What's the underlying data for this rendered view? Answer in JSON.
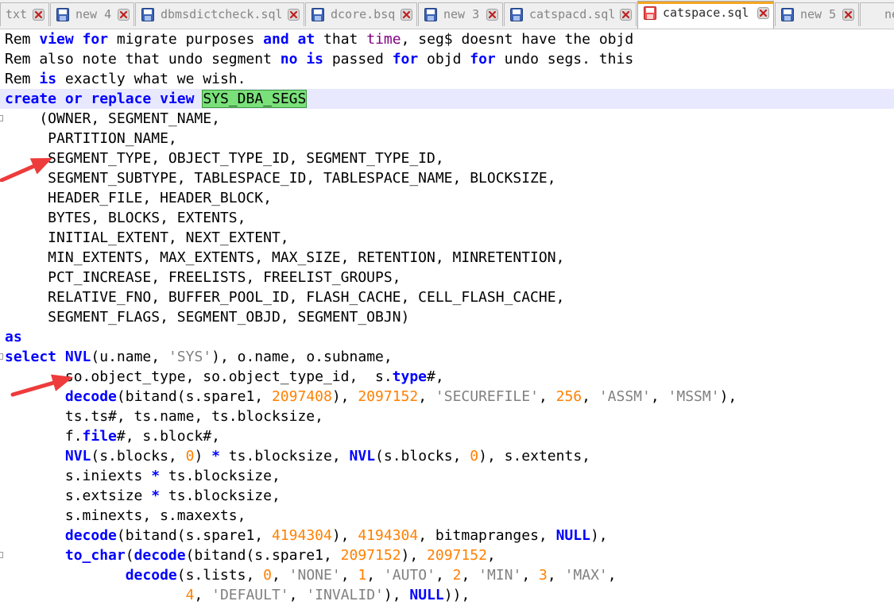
{
  "tabs": [
    {
      "label": "txt",
      "icon": "none",
      "active": false
    },
    {
      "label": "new 4",
      "icon": "saved-file-icon",
      "active": false
    },
    {
      "label": "dbmsdictcheck.sql",
      "icon": "saved-file-icon",
      "active": false
    },
    {
      "label": "dcore.bsq",
      "icon": "saved-file-icon",
      "active": false
    },
    {
      "label": "new 3",
      "icon": "saved-file-icon",
      "active": false
    },
    {
      "label": "catspacd.sql",
      "icon": "saved-file-icon",
      "active": false
    },
    {
      "label": "catspace.sql",
      "icon": "unsaved-file-icon",
      "active": true
    },
    {
      "label": "new 5",
      "icon": "saved-file-icon",
      "active": false
    },
    {
      "label": "ne",
      "icon": "none",
      "active": false
    }
  ],
  "colors": {
    "keyword": "#0000ff",
    "function": "#800080",
    "string": "#808080",
    "number": "#ff8000",
    "selection": "#7ae07a",
    "current_line": "#e8e8ff",
    "active_tab_accent": "#f5a623",
    "annotation_arrow": "#ee3b3b"
  },
  "code_lines": [
    [
      [
        "Rem ",
        ""
      ],
      [
        "view",
        "kw"
      ],
      [
        " ",
        ""
      ],
      [
        "for",
        "kw"
      ],
      [
        " migrate purposes ",
        ""
      ],
      [
        "and",
        "kw"
      ],
      [
        " ",
        ""
      ],
      [
        "at",
        "kw"
      ],
      [
        " that ",
        ""
      ],
      [
        "time",
        "fn"
      ],
      [
        ", seg$ doesnt have the objd",
        ""
      ]
    ],
    [
      [
        "Rem also note that undo segment ",
        ""
      ],
      [
        "no",
        "kw"
      ],
      [
        " ",
        ""
      ],
      [
        "is",
        "kw"
      ],
      [
        " passed ",
        ""
      ],
      [
        "for",
        "kw"
      ],
      [
        " objd ",
        ""
      ],
      [
        "for",
        "kw"
      ],
      [
        " undo segs. this",
        ""
      ]
    ],
    [
      [
        "Rem ",
        ""
      ],
      [
        "is",
        "kw"
      ],
      [
        " exactly what we wish.",
        ""
      ]
    ],
    [
      [
        "create",
        "kw"
      ],
      [
        " ",
        ""
      ],
      [
        "or",
        "kw"
      ],
      [
        " ",
        ""
      ],
      [
        "replace",
        "kw"
      ],
      [
        " ",
        ""
      ],
      [
        "view",
        "kw"
      ],
      [
        " ",
        ""
      ],
      [
        "SYS_DBA_SEGS",
        "sel"
      ]
    ],
    [
      [
        "    (OWNER, SEGMENT_NAME,",
        ""
      ]
    ],
    [
      [
        "     PARTITION_NAME,",
        ""
      ]
    ],
    [
      [
        "     SEGMENT_TYPE, OBJECT_TYPE_ID, SEGMENT_TYPE_ID,",
        ""
      ]
    ],
    [
      [
        "     SEGMENT_SUBTYPE, TABLESPACE_ID, TABLESPACE_NAME, BLOCKSIZE,",
        ""
      ]
    ],
    [
      [
        "     HEADER_FILE, HEADER_BLOCK,",
        ""
      ]
    ],
    [
      [
        "     BYTES, BLOCKS, EXTENTS,",
        ""
      ]
    ],
    [
      [
        "     INITIAL_EXTENT, NEXT_EXTENT,",
        ""
      ]
    ],
    [
      [
        "     MIN_EXTENTS, MAX_EXTENTS, MAX_SIZE, RETENTION, MINRETENTION,",
        ""
      ]
    ],
    [
      [
        "     PCT_INCREASE, FREELISTS, FREELIST_GROUPS,",
        ""
      ]
    ],
    [
      [
        "     RELATIVE_FNO, BUFFER_POOL_ID, FLASH_CACHE, CELL_FLASH_CACHE,",
        ""
      ]
    ],
    [
      [
        "     SEGMENT_FLAGS, SEGMENT_OBJD, SEGMENT_OBJN)",
        ""
      ]
    ],
    [
      [
        "as",
        "kw"
      ]
    ],
    [
      [
        "select",
        "kw"
      ],
      [
        " ",
        ""
      ],
      [
        "NVL",
        "kw"
      ],
      [
        "(u.name, ",
        ""
      ],
      [
        "'SYS'",
        "str"
      ],
      [
        "), o.name, o.subname,",
        ""
      ]
    ],
    [
      [
        "       so.object_type, so.object_type_id,  s.",
        ""
      ],
      [
        "type",
        "kw"
      ],
      [
        "#,",
        ""
      ]
    ],
    [
      [
        "       ",
        ""
      ],
      [
        "decode",
        "kw"
      ],
      [
        "(bitand(s.spare1, ",
        ""
      ],
      [
        "2097408",
        "num"
      ],
      [
        "), ",
        ""
      ],
      [
        "2097152",
        "num"
      ],
      [
        ", ",
        ""
      ],
      [
        "'SECUREFILE'",
        "str"
      ],
      [
        ", ",
        ""
      ],
      [
        "256",
        "num"
      ],
      [
        ", ",
        ""
      ],
      [
        "'ASSM'",
        "str"
      ],
      [
        ", ",
        ""
      ],
      [
        "'MSSM'",
        "str"
      ],
      [
        "),",
        ""
      ]
    ],
    [
      [
        "       ts.ts#, ts.name, ts.blocksize,",
        ""
      ]
    ],
    [
      [
        "       f.",
        ""
      ],
      [
        "file",
        "kw"
      ],
      [
        "#, s.block#,",
        ""
      ]
    ],
    [
      [
        "       ",
        ""
      ],
      [
        "NVL",
        "kw"
      ],
      [
        "(s.blocks, ",
        ""
      ],
      [
        "0",
        "num"
      ],
      [
        ") ",
        ""
      ],
      [
        "*",
        "kw"
      ],
      [
        " ts.blocksize, ",
        ""
      ],
      [
        "NVL",
        "kw"
      ],
      [
        "(s.blocks, ",
        ""
      ],
      [
        "0",
        "num"
      ],
      [
        "), s.extents,",
        ""
      ]
    ],
    [
      [
        "       s.iniexts ",
        ""
      ],
      [
        "*",
        "kw"
      ],
      [
        " ts.blocksize,",
        ""
      ]
    ],
    [
      [
        "       s.extsize ",
        ""
      ],
      [
        "*",
        "kw"
      ],
      [
        " ts.blocksize,",
        ""
      ]
    ],
    [
      [
        "       s.minexts, s.maxexts,",
        ""
      ]
    ],
    [
      [
        "       ",
        ""
      ],
      [
        "decode",
        "kw"
      ],
      [
        "(bitand(s.spare1, ",
        ""
      ],
      [
        "4194304",
        "num"
      ],
      [
        "), ",
        ""
      ],
      [
        "4194304",
        "num"
      ],
      [
        ", bitmapranges, ",
        ""
      ],
      [
        "NULL",
        "kw"
      ],
      [
        "),",
        ""
      ]
    ],
    [
      [
        "       ",
        ""
      ],
      [
        "to_char",
        "kw"
      ],
      [
        "(",
        ""
      ],
      [
        "decode",
        "kw"
      ],
      [
        "(bitand(s.spare1, ",
        ""
      ],
      [
        "2097152",
        "num"
      ],
      [
        "), ",
        ""
      ],
      [
        "2097152",
        "num"
      ],
      [
        ",",
        ""
      ]
    ],
    [
      [
        "              ",
        ""
      ],
      [
        "decode",
        "kw"
      ],
      [
        "(s.lists, ",
        ""
      ],
      [
        "0",
        "num"
      ],
      [
        ", ",
        ""
      ],
      [
        "'NONE'",
        "str"
      ],
      [
        ", ",
        ""
      ],
      [
        "1",
        "num"
      ],
      [
        ", ",
        ""
      ],
      [
        "'AUTO'",
        "str"
      ],
      [
        ", ",
        ""
      ],
      [
        "2",
        "num"
      ],
      [
        ", ",
        ""
      ],
      [
        "'MIN'",
        "str"
      ],
      [
        ", ",
        ""
      ],
      [
        "3",
        "num"
      ],
      [
        ", ",
        ""
      ],
      [
        "'MAX'",
        "str"
      ],
      [
        ",",
        ""
      ]
    ],
    [
      [
        "                     ",
        ""
      ],
      [
        "4",
        "num"
      ],
      [
        ", ",
        ""
      ],
      [
        "'DEFAULT'",
        "str"
      ],
      [
        ", ",
        ""
      ],
      [
        "'INVALID'",
        "str"
      ],
      [
        "), ",
        ""
      ],
      [
        "NULL",
        "kw"
      ],
      [
        ")),",
        ""
      ]
    ]
  ]
}
